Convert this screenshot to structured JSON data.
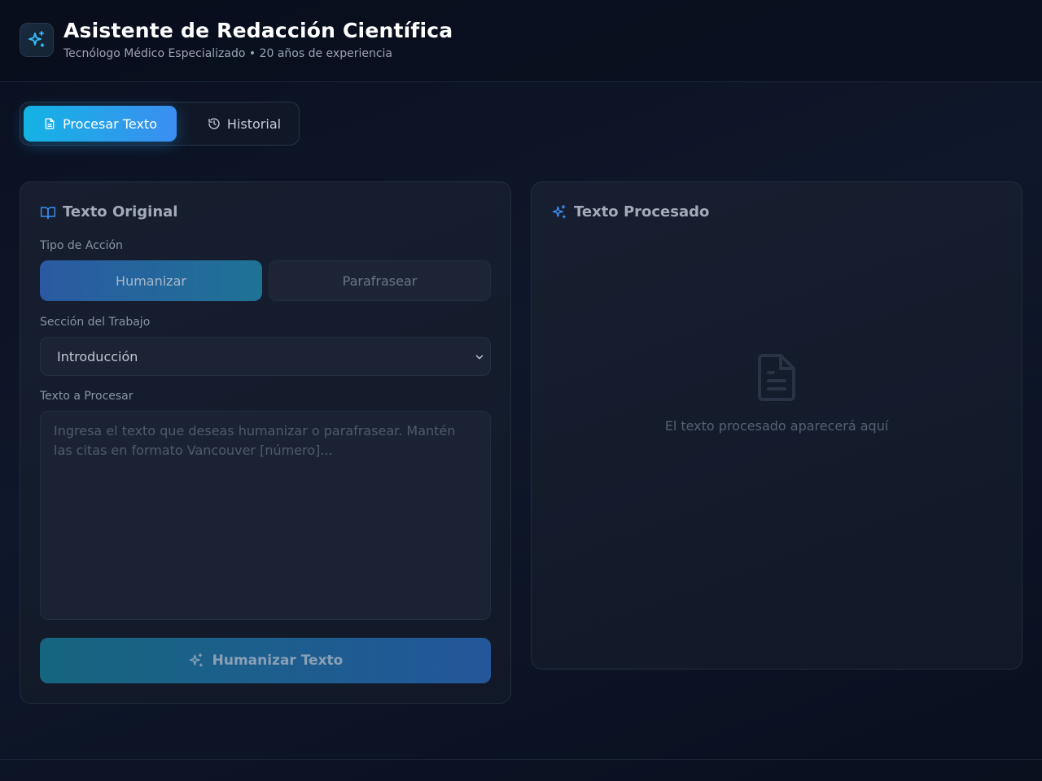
{
  "header": {
    "title": "Asistente de Redacción Científica",
    "subtitle": "Tecnólogo Médico Especializado • 20 años de experiencia",
    "logo_icon": "sparkles-icon"
  },
  "tabs": [
    {
      "label": "Procesar Texto",
      "icon": "document-icon",
      "active": true
    },
    {
      "label": "Historial",
      "icon": "history-icon",
      "active": false
    }
  ],
  "left_panel": {
    "title": "Texto Original",
    "title_icon": "book-open-icon",
    "action_label": "Tipo de Acción",
    "actions": [
      {
        "label": "Humanizar",
        "selected": true
      },
      {
        "label": "Parafrasear",
        "selected": false
      }
    ],
    "section_label": "Sección del Trabajo",
    "section_value": "Introducción",
    "text_label": "Texto a Procesar",
    "text_placeholder": "Ingresa el texto que deseas humanizar o parafrasear. Mantén las citas en formato Vancouver [número]...",
    "submit_label": "Humanizar Texto"
  },
  "right_panel": {
    "title": "Texto Procesado",
    "title_icon": "sparkles-icon",
    "empty_icon": "file-text-icon",
    "empty_message": "El texto procesado aparecerá aquí"
  },
  "colors": {
    "accent": "#14b3e4",
    "accent_end": "#3b8ef0",
    "background": "#0f172a"
  }
}
